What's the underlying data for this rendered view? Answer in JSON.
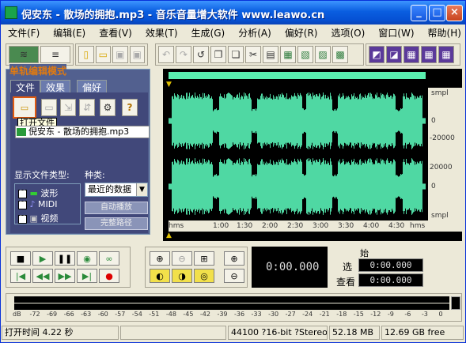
{
  "window": {
    "title": "倪安东 - 散场的拥抱.mp3 - 音乐音量增大软件 www.leawo.cn",
    "min": "_",
    "max": "□",
    "close": "×"
  },
  "menu": [
    "文件(F)",
    "编辑(E)",
    "查看(V)",
    "效果(T)",
    "生成(G)",
    "分析(A)",
    "偏好(R)",
    "选项(O)",
    "窗口(W)",
    "帮助(H)"
  ],
  "mode_label": "单轨编辑模式",
  "tabs": {
    "file": "文件",
    "effects": "效果",
    "prefs": "偏好"
  },
  "tooltip": "打开文件",
  "file_item": "倪安东 - 散场的拥抱.mp3",
  "filter": {
    "type_label": "显示文件类型:",
    "kind_label": "种类:",
    "waveform": "波形",
    "midi": "MIDI",
    "video": "视频",
    "dropdown_value": "最近的数据",
    "auto_play": "自动播放",
    "full_path": "完整路径"
  },
  "wave": {
    "unit": "smpl",
    "zero": "0",
    "neg": "-20000",
    "pos": "20000"
  },
  "timeline": {
    "labels": [
      "hms",
      "1:00",
      "1:30",
      "2:00",
      "2:30",
      "3:00",
      "3:30",
      "4:00",
      "4:30",
      "hms"
    ]
  },
  "transport": {
    "time": "0:00.000"
  },
  "selection": {
    "start_label": "始",
    "sel_label": "选",
    "view_label": "查看",
    "sel_value": "0:00.000",
    "view_value": "0:00.000"
  },
  "meter": {
    "ticks": [
      "dB",
      "-72",
      "-69",
      "-66",
      "-63",
      "-60",
      "-57",
      "-54",
      "-51",
      "-48",
      "-45",
      "-42",
      "-39",
      "-36",
      "-33",
      "-30",
      "-27",
      "-24",
      "-21",
      "-18",
      "-15",
      "-12",
      "-9",
      "-6",
      "-3",
      "0"
    ]
  },
  "status": {
    "open_time": "打开时间 4.22 秒",
    "format": "44100 ?16-bit ?Stereo",
    "size": "52.18 MB",
    "free": "12.69 GB free"
  }
}
